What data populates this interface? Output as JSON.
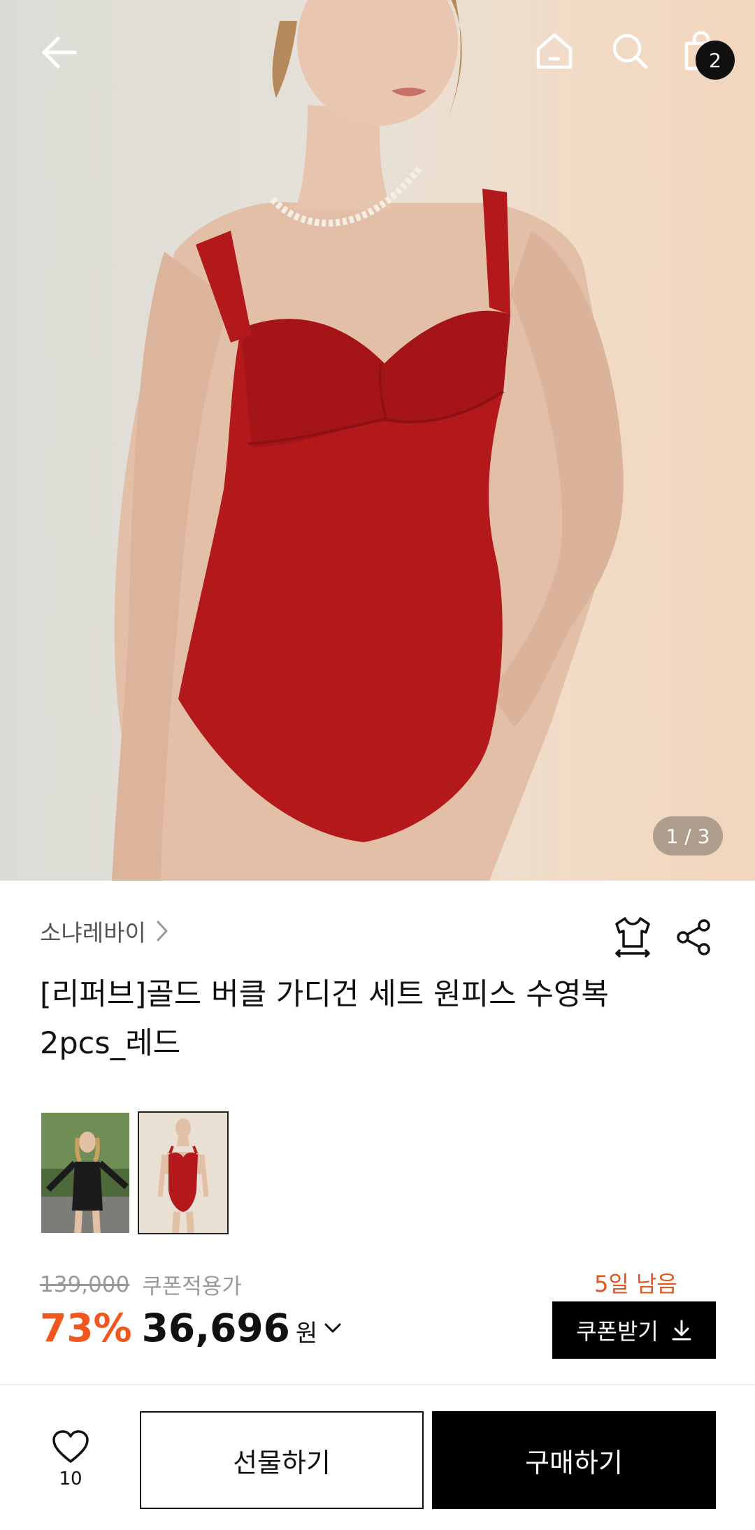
{
  "header": {
    "back_icon": "arrow-left-icon",
    "home_icon": "home-icon",
    "search_icon": "search-icon",
    "cart_icon": "shopping-bag-icon",
    "cart_count": "2"
  },
  "gallery": {
    "pager": "1 / 3",
    "thumbnails": [
      {
        "alt": "black-swimsuit-thumbnail",
        "active": false
      },
      {
        "alt": "red-swimsuit-thumbnail",
        "active": true
      }
    ]
  },
  "product": {
    "brand": "소냐레바이",
    "title_line1": "[리퍼브]골드 버클 가디건 세트 원피스 수영복",
    "title_line2": "2pcs_레드",
    "size_icon": "tshirt-size-icon",
    "share_icon": "share-icon"
  },
  "pricing": {
    "original_price": "139,000",
    "coupon_note": "쿠폰적용가",
    "discount": "73%",
    "price": "36,696",
    "currency": "원",
    "days_left": "5일 남음",
    "coupon_button": "쿠폰받기",
    "accent_color": "#f0561d"
  },
  "bottom_bar": {
    "like_count": "10",
    "gift_label": "선물하기",
    "buy_label": "구매하기"
  }
}
